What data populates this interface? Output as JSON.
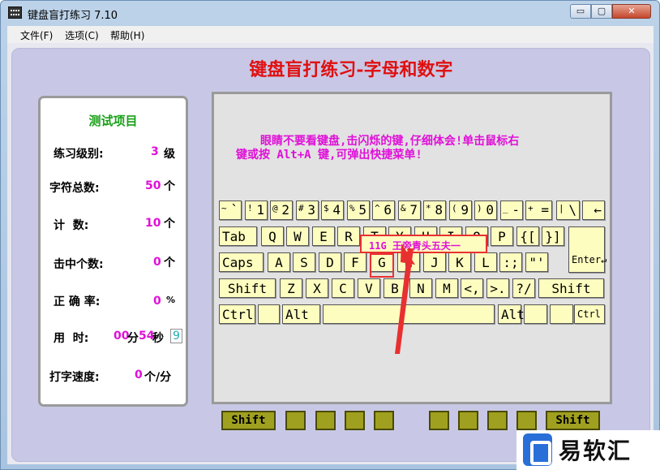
{
  "window": {
    "title": "键盘盲打练习 7.10",
    "buttons": {
      "minimize": "▭",
      "maximize": "▢",
      "close": "✕"
    }
  },
  "menu": {
    "items": [
      "文件(F)",
      "选项(C)",
      "帮助(H)"
    ]
  },
  "main_title": "键盘盲打练习-字母和数字",
  "stats": {
    "title": "测试项目",
    "level_label": "练习级别:",
    "level_value": "3",
    "level_unit": "级",
    "total_label": "字符总数:",
    "total_value": "50",
    "total_unit": "个",
    "count_label": "计  数:",
    "count_value": "10",
    "count_unit": "个",
    "hits_label": "击中个数:",
    "hits_value": "0",
    "hits_unit": "个",
    "accuracy_label": "正 确 率:",
    "accuracy_value": "0",
    "accuracy_unit": "%",
    "time_label": "用  时:",
    "time_min": "00",
    "time_min_unit": "分",
    "time_sec": "54",
    "time_sec_unit": "秒",
    "time_box": "9",
    "speed_label": "打字速度:",
    "speed_value": "0",
    "speed_unit": "个/分"
  },
  "instructions": [
    "眼睛不要看键盘,击闪烁的键,仔细体会!单击鼠标右",
    "键或按 Alt+A 键,可弹出快捷菜单!"
  ],
  "annotation": {
    "text": "11G 王旁青头五夫一"
  },
  "keyboard": {
    "row1": [
      {
        "sh": "~",
        "mn": "`"
      },
      {
        "sh": "!",
        "mn": "1"
      },
      {
        "sh": "@",
        "mn": "2"
      },
      {
        "sh": "#",
        "mn": "3"
      },
      {
        "sh": "$",
        "mn": "4"
      },
      {
        "sh": "%",
        "mn": "5"
      },
      {
        "sh": "^",
        "mn": "6"
      },
      {
        "sh": "&",
        "mn": "7"
      },
      {
        "sh": "*",
        "mn": "8"
      },
      {
        "sh": "(",
        "mn": "9"
      },
      {
        "sh": ")",
        "mn": "0"
      },
      {
        "sh": "_",
        "mn": "-"
      },
      {
        "sh": "+",
        "mn": "="
      },
      {
        "sh": "|",
        "mn": "\\"
      },
      {
        "sh": "",
        "mn": "←"
      }
    ],
    "row2": [
      "Tab",
      "Q",
      "W",
      "E",
      "R",
      "T",
      "Y",
      "U",
      "I",
      "O",
      "P",
      "{[",
      "}]"
    ],
    "row3": [
      "Caps",
      "A",
      "S",
      "D",
      "F",
      "G",
      "H",
      "J",
      "K",
      "L",
      ":;",
      "\"'"
    ],
    "row4": [
      "Shift",
      "Z",
      "X",
      "C",
      "V",
      "B",
      "N",
      "M",
      "<,",
      ">.",
      "?/",
      "Shift"
    ],
    "row5": [
      "Ctrl",
      "",
      "Alt",
      "",
      "Alt",
      "",
      "",
      "Ctrl"
    ],
    "enter_label": "Enter↵"
  },
  "fingers": {
    "left_shift": "Shift",
    "right_shift": "Shift"
  },
  "watermark": {
    "text": "易软汇"
  }
}
